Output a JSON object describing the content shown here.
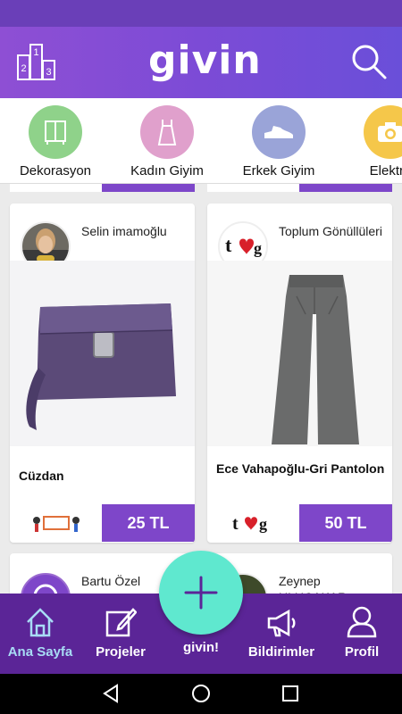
{
  "app": {
    "logo": "givin"
  },
  "header": {
    "leaderboard_icon": "podium-icon",
    "search_icon": "search-icon",
    "podium_digits": [
      "2",
      "1",
      "3"
    ]
  },
  "categories": [
    {
      "label": "Dekorasyon",
      "color": "#8fd28a"
    },
    {
      "label": "Kadın Giyim",
      "color": "#e0a0cc"
    },
    {
      "label": "Erkek Giyim",
      "color": "#9aa4d8"
    },
    {
      "label": "Elektro",
      "color": "#f5c74a"
    }
  ],
  "cards": [
    {
      "user": "Selin imamoğlu",
      "title": "Cüzdan",
      "price": "25 TL"
    },
    {
      "user": "Toplum Gönüllüleri",
      "title": "Ece Vahapoğlu-Gri Pantolon",
      "price": "50 TL"
    },
    {
      "user": "Bartu Özel",
      "title": "",
      "price": ""
    },
    {
      "user": "Zeynep ULUCAKAR",
      "title": "",
      "price": ""
    }
  ],
  "fab": {
    "icon": "plus-icon"
  },
  "nav": [
    {
      "label": "Ana Sayfa",
      "icon": "home-icon",
      "active": true
    },
    {
      "label": "Projeler",
      "icon": "edit-icon",
      "active": false
    },
    {
      "label": "givin!",
      "icon": "",
      "active": false
    },
    {
      "label": "Bildirimler",
      "icon": "megaphone-icon",
      "active": false
    },
    {
      "label": "Profil",
      "icon": "user-icon",
      "active": false
    }
  ],
  "system_nav": {
    "back": "back-icon",
    "home": "home-circle-icon",
    "recents": "recents-icon"
  },
  "colors": {
    "header": "#7c4bd6",
    "accent": "#7e46c9",
    "fab": "#5fe8cf",
    "nav": "#5b2597",
    "active_nav": "#a8dcf5"
  }
}
